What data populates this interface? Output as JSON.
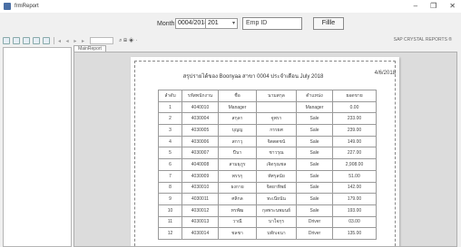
{
  "window": {
    "title": "frmReport",
    "controls": [
      "–",
      "❐",
      "✕"
    ]
  },
  "filter": {
    "month_label": "Month",
    "month_value": "0004/2018",
    "year_value": "201",
    "emp_placeholder": "Emp ID",
    "filter_button": "Fillle"
  },
  "toolbar": {
    "nav_glyphs": "◂ ◂ ▸ ▸",
    "zoom_glyph": "⌕ ⊞ ◈ ·",
    "brand": "SAP CRYSTAL REPORTS ®"
  },
  "preview": {
    "tab_label": "MainReport"
  },
  "report": {
    "title": "สรุปรายได้ของ Boonyaa สาขา 0004 ประจำเดือน July 2018",
    "date": "4/6/2018",
    "headers": [
      "ลำดับ",
      "รหัสพนักงาน",
      "ชื่อ",
      "นามสกุล",
      "ตำแหน่ง",
      "ยอดขาย"
    ],
    "rows": [
      [
        "1",
        "4040010",
        "Manager",
        "",
        "Manager",
        "0.00"
      ],
      [
        "2",
        "4030004",
        "สกุลา",
        "จูพรา",
        "Sale",
        "233.00"
      ],
      [
        "3",
        "4030005",
        "บุญญ",
        "กรรยศ",
        "Sale",
        "239.00"
      ],
      [
        "4",
        "4030006",
        "สกาวุ",
        "จิตตตชนั",
        "Sale",
        "149.00"
      ],
      [
        "5",
        "4030007",
        "ปีนา",
        "ชาวรุณ",
        "Sale",
        "227.00"
      ],
      [
        "6",
        "4040008",
        "สามธุภูร",
        "เจิดรุณชล",
        "Sale",
        "2,908.00"
      ],
      [
        "7",
        "4030009",
        "พรรกุ",
        "ทัศรุลนัย",
        "Sale",
        "51.00"
      ],
      [
        "8",
        "4030010",
        "ธงกาย",
        "จิตยาทิพย์",
        "Sale",
        "142.00"
      ],
      [
        "9",
        "4030011",
        "ศลิกล",
        "ทะเนียนัน",
        "Sale",
        "179.00"
      ],
      [
        "10",
        "4030012",
        "ทรพัฒ",
        "กุลพระนพมนย์",
        "Sale",
        "193.00"
      ],
      [
        "11",
        "4030013",
        "วาณี",
        "บาใจกุร",
        "Driver",
        "03.00"
      ],
      [
        "12",
        "4030014",
        "ชลชา",
        "บพักเจนา",
        "Driver",
        "135.00"
      ]
    ]
  }
}
